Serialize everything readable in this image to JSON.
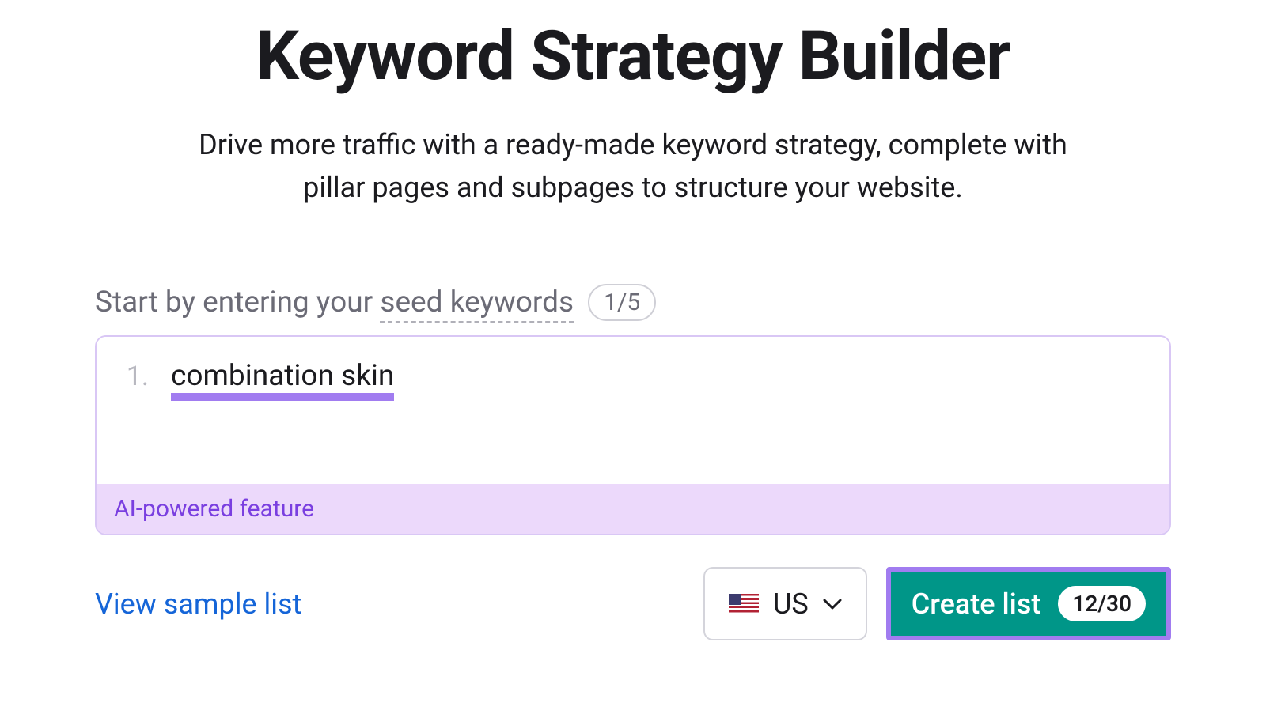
{
  "header": {
    "title": "Keyword Strategy Builder",
    "subtitle": "Drive more traffic with a ready-made keyword strategy, complete with pillar pages and subpages to structure your website."
  },
  "prompt": {
    "prefix": "Start by entering your ",
    "seed_label": "seed keywords",
    "counter": "1/5"
  },
  "input": {
    "items": [
      {
        "num": "1.",
        "text": "combination skin"
      }
    ],
    "ai_banner": "AI-powered feature"
  },
  "footer": {
    "sample_link": "View sample list",
    "country": {
      "code": "US"
    },
    "create": {
      "label": "Create list",
      "count": "12/30"
    }
  }
}
